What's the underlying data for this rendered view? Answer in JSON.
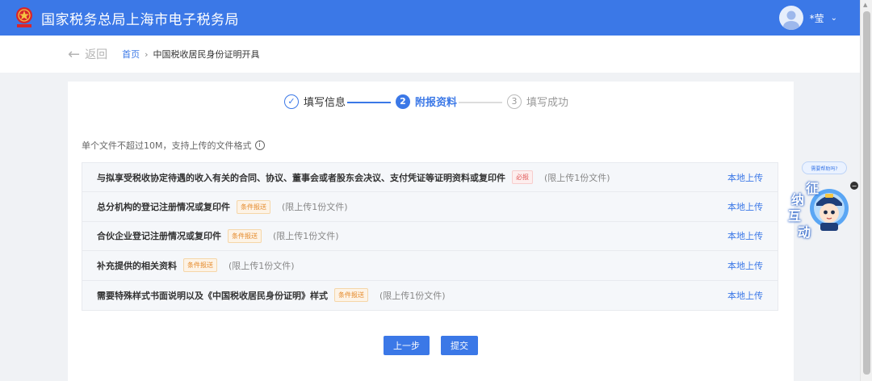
{
  "header": {
    "title": "国家税务总局上海市电子税务局",
    "user_name": "*莹",
    "colors": {
      "primary": "#3b78e7"
    },
    "logo_icon": "tax-emblem-icon",
    "avatar_icon": "user-avatar-icon",
    "caret_icon": "chevron-down-icon"
  },
  "breadcrumb": {
    "back_label": "返回",
    "home": "首页",
    "separator": "›",
    "current": "中国税收居民身份证明开具"
  },
  "steps": [
    {
      "number": "✓",
      "label": "填写信息",
      "state": "done"
    },
    {
      "number": "2",
      "label": "附报资料",
      "state": "active"
    },
    {
      "number": "3",
      "label": "填写成功",
      "state": "pending"
    }
  ],
  "hint": {
    "text": "单个文件不超过10M，支持上传的文件格式",
    "info_symbol": "i"
  },
  "files": [
    {
      "name": "与拟享受税收协定待遇的收入有关的合同、协议、董事会或者股东会决议、支付凭证等证明资料或复印件",
      "tag": "必报",
      "tag_type": "required",
      "limit": "(限上传1份文件)",
      "action": "本地上传"
    },
    {
      "name": "总分机构的登记注册情况或复印件",
      "tag": "条件报送",
      "tag_type": "conditional",
      "limit": "(限上传1份文件)",
      "action": "本地上传"
    },
    {
      "name": "合伙企业登记注册情况或复印件",
      "tag": "条件报送",
      "tag_type": "conditional",
      "limit": "(限上传1份文件)",
      "action": "本地上传"
    },
    {
      "name": "补充提供的相关资料",
      "tag": "条件报送",
      "tag_type": "conditional",
      "limit": "(限上传1份文件)",
      "action": "本地上传"
    },
    {
      "name": "需要特殊样式书面说明以及《中国税收居民身份证明》样式",
      "tag": "条件报送",
      "tag_type": "conditional",
      "limit": "(限上传1份文件)",
      "action": "本地上传"
    }
  ],
  "buttons": {
    "prev": "上一步",
    "submit": "提交"
  },
  "assistant": {
    "bubble": "需要帮助吗?",
    "chars": [
      "征",
      "纳",
      "互",
      "动"
    ],
    "close": "−"
  }
}
